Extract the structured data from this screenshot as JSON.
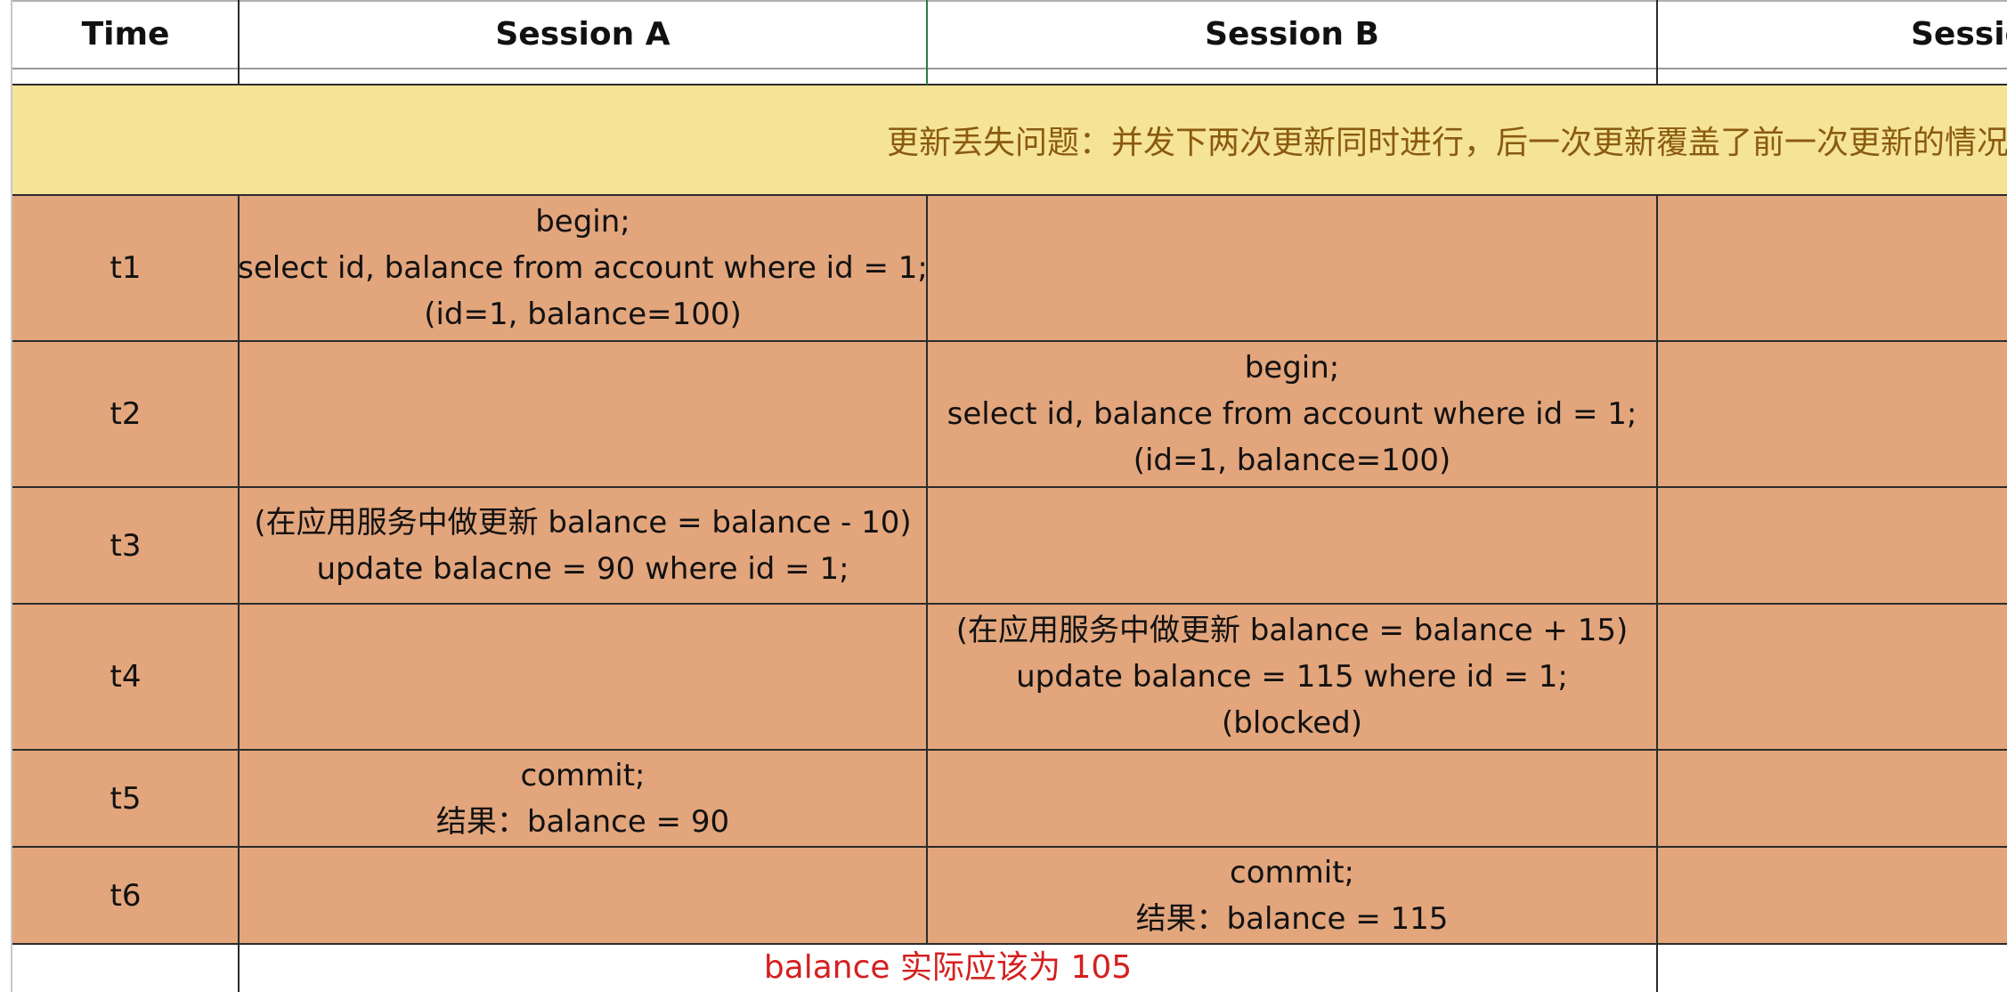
{
  "header": {
    "time": "Time",
    "session_a": "Session A",
    "session_b": "Session B",
    "session_c_partial": "Sessio"
  },
  "banner": {
    "text": "更新丢失问题：并发下两次更新同时进行，后一次更新覆盖了前一次更新的情况"
  },
  "rows": [
    {
      "time": "t1",
      "session_a": [
        "begin;",
        "select id, balance from account where id = 1;",
        "(id=1, balance=100)"
      ],
      "session_b": []
    },
    {
      "time": "t2",
      "session_a": [],
      "session_b": [
        "begin;",
        "select id, balance from account where id = 1;",
        "(id=1, balance=100)"
      ]
    },
    {
      "time": "t3",
      "session_a": [
        "(在应用服务中做更新 balance = balance - 10)",
        "update balacne = 90 where id = 1;"
      ],
      "session_b": []
    },
    {
      "time": "t4",
      "session_a": [],
      "session_b": [
        "(在应用服务中做更新 balance = balance + 15)",
        "update balance = 115 where id = 1;",
        "(blocked)"
      ]
    },
    {
      "time": "t5",
      "session_a": [
        "commit;",
        "结果：balance = 90"
      ],
      "session_b": []
    },
    {
      "time": "t6",
      "session_a": [],
      "session_b": [
        "commit;",
        "结果：balance = 115"
      ]
    }
  ],
  "footer": {
    "note": "balance 实际应该为 105"
  },
  "colors": {
    "row_fill": "#e2a57c",
    "banner_fill": "#f6e496",
    "banner_text": "#8a5a12",
    "note_text": "#d42020"
  }
}
